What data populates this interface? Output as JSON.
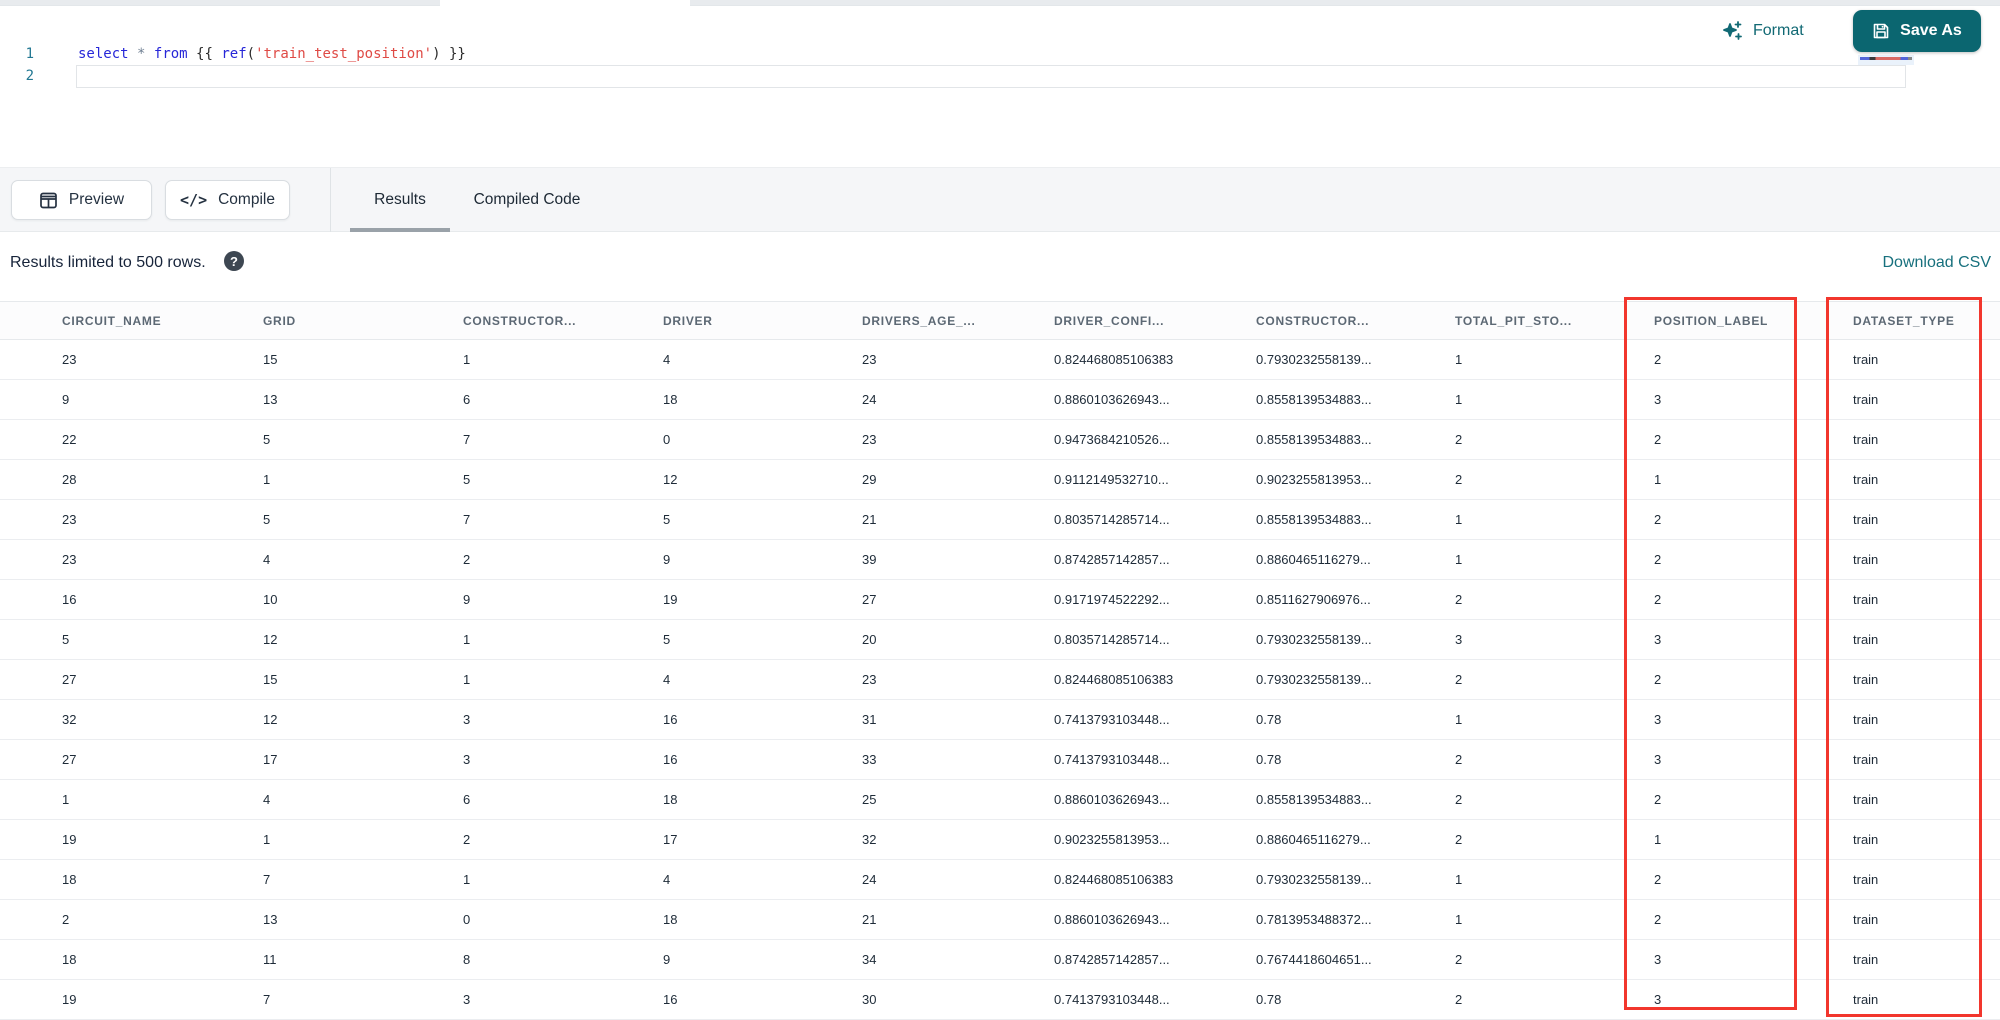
{
  "editor": {
    "line_numbers": [
      "1",
      "2"
    ],
    "code_tokens": [
      {
        "t": "select",
        "c": "kw"
      },
      {
        "t": " ",
        "c": "plain"
      },
      {
        "t": "*",
        "c": "op"
      },
      {
        "t": " ",
        "c": "plain"
      },
      {
        "t": "from",
        "c": "kw"
      },
      {
        "t": " ",
        "c": "plain"
      },
      {
        "t": "{{",
        "c": "brace"
      },
      {
        "t": " ",
        "c": "plain"
      },
      {
        "t": "ref",
        "c": "fn"
      },
      {
        "t": "(",
        "c": "brace"
      },
      {
        "t": "'train_test_position'",
        "c": "str"
      },
      {
        "t": ")",
        "c": "brace"
      },
      {
        "t": " ",
        "c": "plain"
      },
      {
        "t": "}}",
        "c": "brace"
      }
    ],
    "format_label": "Format",
    "save_as_label": "Save As"
  },
  "toolbar": {
    "preview_label": "Preview",
    "compile_label": "Compile",
    "compile_glyph": "</>",
    "tabs": [
      {
        "label": "Results",
        "active": true
      },
      {
        "label": "Compiled Code",
        "active": false
      }
    ]
  },
  "results_bar": {
    "limit_text": "Results limited to 500 rows.",
    "help_glyph": "?",
    "download_label": "Download CSV"
  },
  "table": {
    "columns": [
      "CIRCUIT_NAME",
      "GRID",
      "CONSTRUCTOR...",
      "DRIVER",
      "DRIVERS_AGE_...",
      "DRIVER_CONFI...",
      "CONSTRUCTOR...",
      "TOTAL_PIT_STO...",
      "POSITION_LABEL",
      "DATASET_TYPE"
    ],
    "rows": [
      [
        "23",
        "15",
        "1",
        "4",
        "23",
        "0.824468085106383",
        "0.7930232558139...",
        "1",
        "2",
        "train"
      ],
      [
        "9",
        "13",
        "6",
        "18",
        "24",
        "0.8860103626943...",
        "0.8558139534883...",
        "1",
        "3",
        "train"
      ],
      [
        "22",
        "5",
        "7",
        "0",
        "23",
        "0.9473684210526...",
        "0.8558139534883...",
        "2",
        "2",
        "train"
      ],
      [
        "28",
        "1",
        "5",
        "12",
        "29",
        "0.9112149532710...",
        "0.9023255813953...",
        "2",
        "1",
        "train"
      ],
      [
        "23",
        "5",
        "7",
        "5",
        "21",
        "0.8035714285714...",
        "0.8558139534883...",
        "1",
        "2",
        "train"
      ],
      [
        "23",
        "4",
        "2",
        "9",
        "39",
        "0.8742857142857...",
        "0.8860465116279...",
        "1",
        "2",
        "train"
      ],
      [
        "16",
        "10",
        "9",
        "19",
        "27",
        "0.9171974522292...",
        "0.8511627906976...",
        "2",
        "2",
        "train"
      ],
      [
        "5",
        "12",
        "1",
        "5",
        "20",
        "0.8035714285714...",
        "0.7930232558139...",
        "3",
        "3",
        "train"
      ],
      [
        "27",
        "15",
        "1",
        "4",
        "23",
        "0.824468085106383",
        "0.7930232558139...",
        "2",
        "2",
        "train"
      ],
      [
        "32",
        "12",
        "3",
        "16",
        "31",
        "0.7413793103448...",
        "0.78",
        "1",
        "3",
        "train"
      ],
      [
        "27",
        "17",
        "3",
        "16",
        "33",
        "0.7413793103448...",
        "0.78",
        "2",
        "3",
        "train"
      ],
      [
        "1",
        "4",
        "6",
        "18",
        "25",
        "0.8860103626943...",
        "0.8558139534883...",
        "2",
        "2",
        "train"
      ],
      [
        "19",
        "1",
        "2",
        "17",
        "32",
        "0.9023255813953...",
        "0.8860465116279...",
        "2",
        "1",
        "train"
      ],
      [
        "18",
        "7",
        "1",
        "4",
        "24",
        "0.824468085106383",
        "0.7930232558139...",
        "1",
        "2",
        "train"
      ],
      [
        "2",
        "13",
        "0",
        "18",
        "21",
        "0.8860103626943...",
        "0.7813953488372...",
        "1",
        "2",
        "train"
      ],
      [
        "18",
        "11",
        "8",
        "9",
        "34",
        "0.8742857142857...",
        "0.7674418604651...",
        "2",
        "3",
        "train"
      ],
      [
        "19",
        "7",
        "3",
        "16",
        "30",
        "0.7413793103448...",
        "0.78",
        "2",
        "3",
        "train"
      ]
    ]
  },
  "annotations": {
    "highlight_color": "#f2362d",
    "highlighted_columns": [
      "POSITION_LABEL",
      "DATASET_TYPE"
    ]
  },
  "colors": {
    "accent_teal": "#0b6670",
    "link_teal": "#17707d",
    "keyword_blue": "#2727d8",
    "string_red": "#df4a45",
    "tab_underline": "#9aa2a9"
  }
}
